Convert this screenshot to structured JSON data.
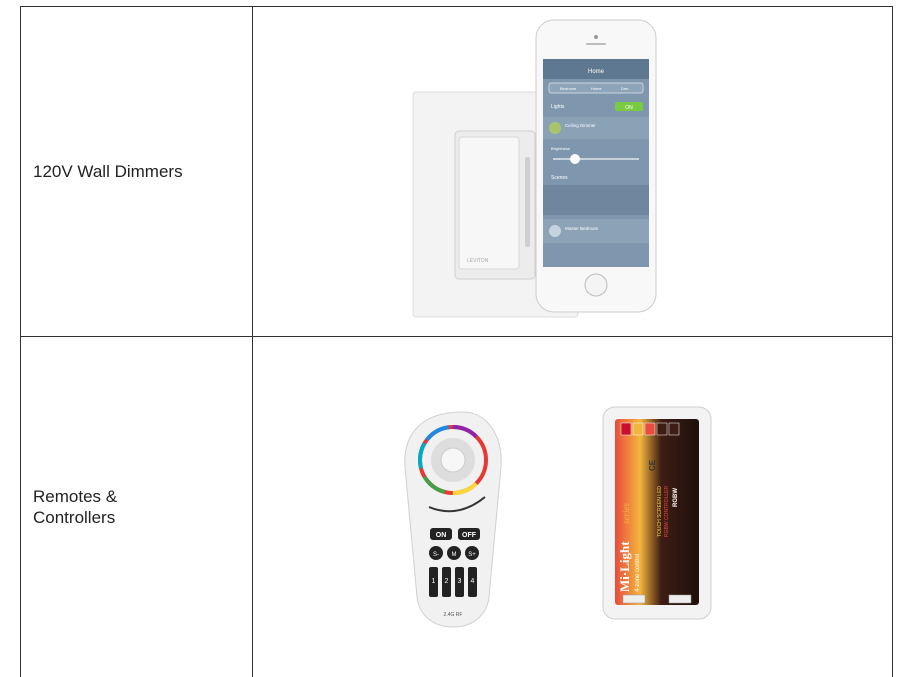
{
  "rows": [
    {
      "label": "120V Wall Dimmers",
      "image": {
        "icons": [
          "wall-dimmer-switch",
          "smartphone-app"
        ],
        "phone_screen": {
          "title": "Home",
          "tabs": [
            "Bedroom",
            "Home",
            "Den"
          ],
          "section_lights": "Lights",
          "toggle": "ON",
          "item1": "Ceiling Dimmer",
          "slider_label": "Brightness",
          "section_scenes": "Scenes",
          "item2": "Master Bedroom"
        }
      }
    },
    {
      "label": "Remotes & Controllers",
      "image": {
        "icons": [
          "rgbw-remote",
          "touch-controller"
        ],
        "remote_buttons": {
          "on": "ON",
          "off": "OFF",
          "s_minus": "S-",
          "m": "M",
          "s_plus": "S+"
        },
        "zones": [
          "1",
          "2",
          "3",
          "4"
        ],
        "remote_footer": "2.4G RF",
        "controller": {
          "brand": "Mi·Light",
          "brand_script": "series",
          "subtitle": "4-zone control",
          "side_text_1": "TOUCH SCREEN LED",
          "side_text_2": "RGBW CONTROLLER",
          "side_text_3": "RGBW",
          "ce": "CE"
        }
      }
    }
  ],
  "colors": {
    "border": "#333333",
    "text": "#222222",
    "app_green": "#7ac943"
  }
}
